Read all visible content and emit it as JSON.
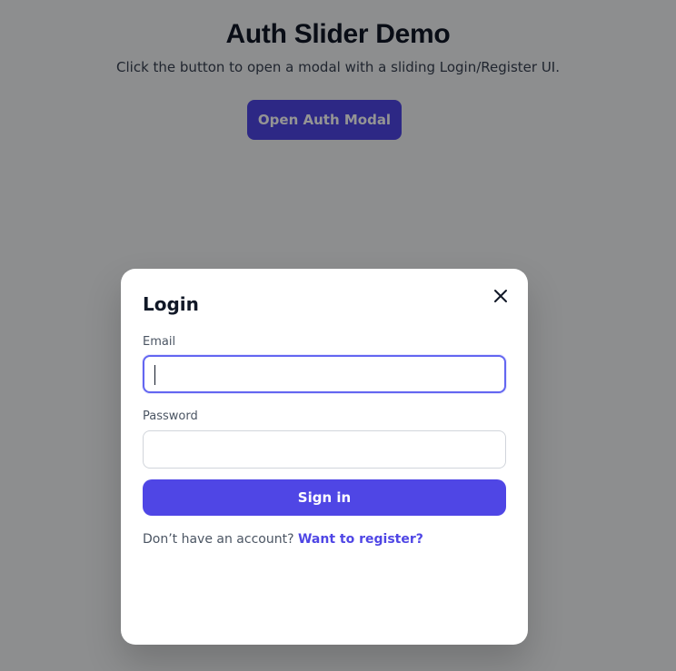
{
  "page": {
    "title": "Auth Slider Demo",
    "subtitle": "Click the button to open a modal with a sliding Login/Register UI.",
    "open_button_label": "Open Auth Modal"
  },
  "modal": {
    "title": "Login",
    "close_icon": "close-icon",
    "email": {
      "label": "Email",
      "value": "",
      "placeholder": ""
    },
    "password": {
      "label": "Password",
      "value": "",
      "placeholder": ""
    },
    "signin_label": "Sign in",
    "switch_prompt": "Don’t have an account?",
    "switch_link": "Want to register?"
  },
  "colors": {
    "accent": "#4f46e5",
    "focus_ring": "#6366f1",
    "overlay": "rgba(0,0,0,0.42)",
    "page_bg": "#f3f4f6",
    "modal_bg": "#ffffff"
  }
}
